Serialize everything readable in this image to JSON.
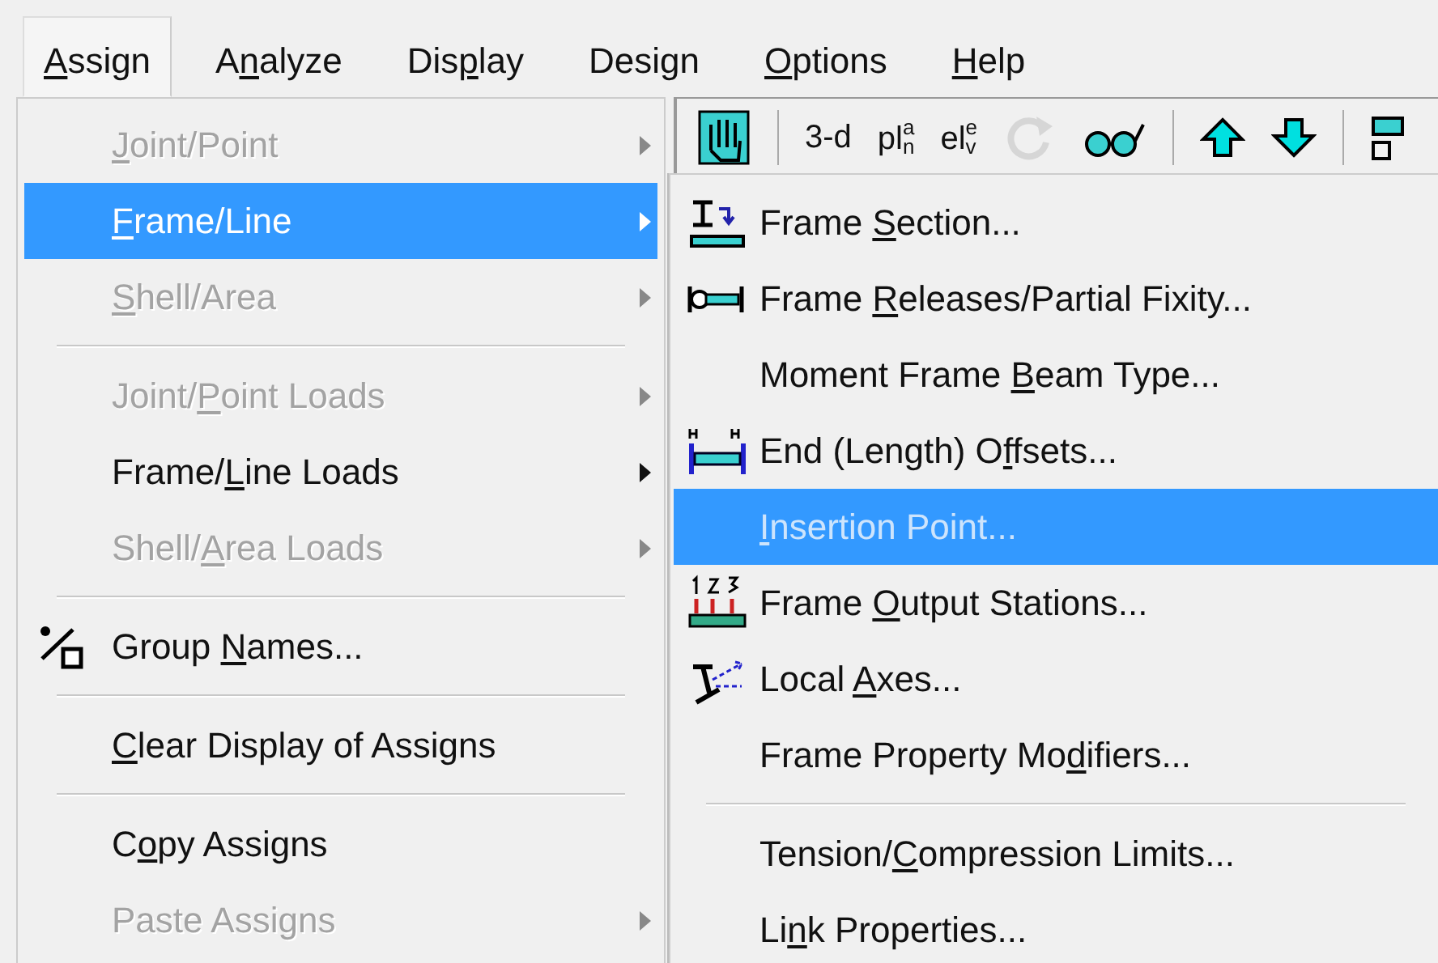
{
  "menubar": [
    {
      "key": "A",
      "post": "ssign",
      "selected": true
    },
    {
      "pre": "A",
      "key": "n",
      "post": "alyze",
      "selected": false
    },
    {
      "pre": "Dis",
      "key": "p",
      "post": "lay",
      "selected": false
    },
    {
      "pre": "Desi",
      "key": "g",
      "post": "n",
      "selected": false
    },
    {
      "key": "O",
      "post": "ptions",
      "selected": false
    },
    {
      "key": "H",
      "post": "elp",
      "selected": false
    }
  ],
  "toolbar": [
    {
      "kind": "icon",
      "disabled": false
    },
    {
      "kind": "sep"
    },
    {
      "kind": "text",
      "text": "3-d"
    },
    {
      "kind": "text",
      "text": "plan"
    },
    {
      "kind": "text",
      "text": "elev"
    },
    {
      "kind": "icon",
      "disabled": true
    },
    {
      "kind": "icon",
      "disabled": false
    },
    {
      "kind": "sep"
    },
    {
      "kind": "icon",
      "disabled": false
    },
    {
      "kind": "icon",
      "disabled": false
    },
    {
      "kind": "sep"
    },
    {
      "kind": "icon",
      "disabled": false
    }
  ],
  "assign_menu": [
    {
      "kind": "item",
      "key": "J",
      "post": "oint/Point",
      "disabled": true,
      "selected": false,
      "submenu": true
    },
    {
      "kind": "item",
      "key": "F",
      "post": "rame/Line",
      "disabled": false,
      "selected": true,
      "submenu": true
    },
    {
      "kind": "item",
      "key": "S",
      "post": "hell/Area",
      "disabled": true,
      "selected": false,
      "submenu": true
    },
    {
      "kind": "separator"
    },
    {
      "kind": "item",
      "pre": "Joint/",
      "key": "P",
      "post": "oint Loads",
      "disabled": true,
      "selected": false,
      "submenu": true
    },
    {
      "kind": "item",
      "pre": "Frame/",
      "key": "L",
      "post": "ine Loads",
      "disabled": false,
      "selected": false,
      "submenu": true
    },
    {
      "kind": "item",
      "pre": "Shell/",
      "key": "A",
      "post": "rea Loads",
      "disabled": true,
      "selected": false,
      "submenu": true
    },
    {
      "kind": "separator"
    },
    {
      "kind": "item",
      "pre": "Group ",
      "key": "N",
      "post": "ames...",
      "disabled": false,
      "selected": false,
      "submenu": false
    },
    {
      "kind": "separator"
    },
    {
      "kind": "item",
      "key": "C",
      "post": "lear Display of Assigns",
      "disabled": false,
      "selected": false,
      "submenu": false
    },
    {
      "kind": "separator"
    },
    {
      "kind": "item",
      "pre": "C",
      "key": "o",
      "post": "py Assigns",
      "disabled": false,
      "selected": false,
      "submenu": false
    },
    {
      "kind": "item",
      "pre": "Paste Assi",
      "key": "g",
      "post": "ns",
      "disabled": true,
      "selected": false,
      "submenu": true
    }
  ],
  "frame_submenu": [
    {
      "kind": "item",
      "pre": "Frame ",
      "key": "S",
      "post": "ection...",
      "disabled": false,
      "selected": false
    },
    {
      "kind": "item",
      "pre": "Frame ",
      "key": "R",
      "post": "eleases/Partial Fixity...",
      "disabled": false,
      "selected": false
    },
    {
      "kind": "item",
      "pre": "Moment Frame ",
      "key": "B",
      "post": "eam Type...",
      "disabled": false,
      "selected": false
    },
    {
      "kind": "item",
      "pre": "End (Length) O",
      "key": "f",
      "post": "fsets...",
      "disabled": false,
      "selected": false
    },
    {
      "kind": "item",
      "key": "I",
      "post": "nsertion Point...",
      "disabled": true,
      "selected": true
    },
    {
      "kind": "item",
      "pre": "Frame ",
      "key": "O",
      "post": "utput Stations...",
      "disabled": false,
      "selected": false
    },
    {
      "kind": "item",
      "pre": "Local ",
      "key": "A",
      "post": "xes...",
      "disabled": false,
      "selected": false
    },
    {
      "kind": "item",
      "pre": "Frame Property Mo",
      "key": "d",
      "post": "ifiers...",
      "disabled": false,
      "selected": false
    },
    {
      "kind": "separator"
    },
    {
      "kind": "item",
      "pre": "Tension/",
      "key": "C",
      "post": "ompression Limits...",
      "disabled": false,
      "selected": false
    },
    {
      "kind": "item",
      "pre": "Li",
      "key": "n",
      "post": "k Properties...",
      "disabled": false,
      "selected": false
    }
  ]
}
